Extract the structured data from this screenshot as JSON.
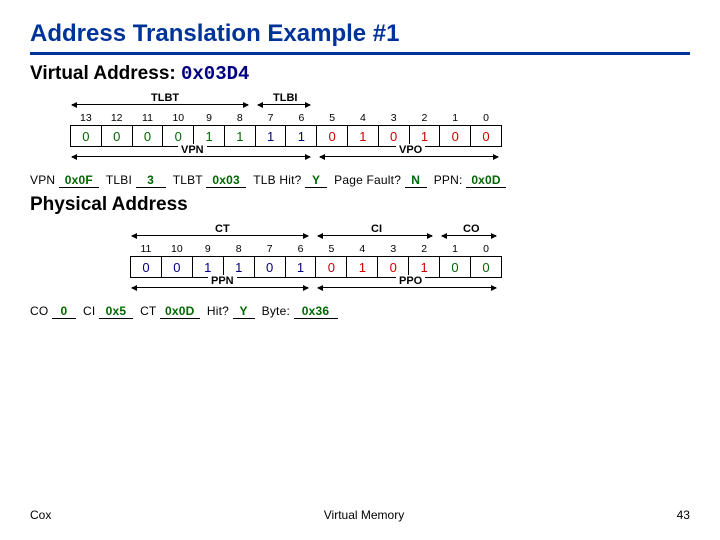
{
  "title": "Address Translation Example #1",
  "va_heading_label": "Virtual Address:",
  "va_heading_value": "0x03D4",
  "va_fields": {
    "tlbt_label": "TLBT",
    "tlbi_label": "TLBI",
    "vpn_label": "VPN",
    "vpo_label": "VPO"
  },
  "va_indices": [
    "13",
    "12",
    "11",
    "10",
    "9",
    "8",
    "7",
    "6",
    "5",
    "4",
    "3",
    "2",
    "1",
    "0"
  ],
  "va_bits": [
    "0",
    "0",
    "0",
    "0",
    "1",
    "1",
    "1",
    "1",
    "0",
    "1",
    "0",
    "1",
    "0",
    "0"
  ],
  "va_colors": [
    "g",
    "g",
    "g",
    "g",
    "g",
    "g",
    "n",
    "n",
    "r",
    "r",
    "r",
    "r",
    "r",
    "r"
  ],
  "va_answers": {
    "vpn_label": "VPN",
    "vpn": "0x0F",
    "tlbi_label": "TLBI",
    "tlbi": "3",
    "tlbt_label": "TLBT",
    "tlbt": "0x03",
    "tlbhit_label": "TLB Hit?",
    "tlbhit": "Y",
    "pf_label": "Page Fault?",
    "pf": "N",
    "ppn_label": "PPN:",
    "ppn": "0x0D"
  },
  "pa_heading": "Physical Address",
  "pa_fields": {
    "ct_label": "CT",
    "ci_label": "CI",
    "co_label": "CO",
    "ppn_label": "PPN",
    "ppo_label": "PPO"
  },
  "pa_indices": [
    "11",
    "10",
    "9",
    "8",
    "7",
    "6",
    "5",
    "4",
    "3",
    "2",
    "1",
    "0"
  ],
  "pa_bits": [
    "0",
    "0",
    "1",
    "1",
    "0",
    "1",
    "0",
    "1",
    "0",
    "1",
    "0",
    "0"
  ],
  "pa_colors": [
    "n",
    "n",
    "n",
    "n",
    "n",
    "n",
    "r",
    "r",
    "r",
    "r",
    "g",
    "g"
  ],
  "pa_answers": {
    "co_label": "CO",
    "co": "0",
    "ci_label": "CI",
    "ci": "0x5",
    "ct_label": "CT",
    "ct": "0x0D",
    "hit_label": "Hit?",
    "hit": "Y",
    "byte_label": "Byte:",
    "byte": "0x36"
  },
  "footer": {
    "left": "Cox",
    "center": "Virtual Memory",
    "right": "43"
  }
}
